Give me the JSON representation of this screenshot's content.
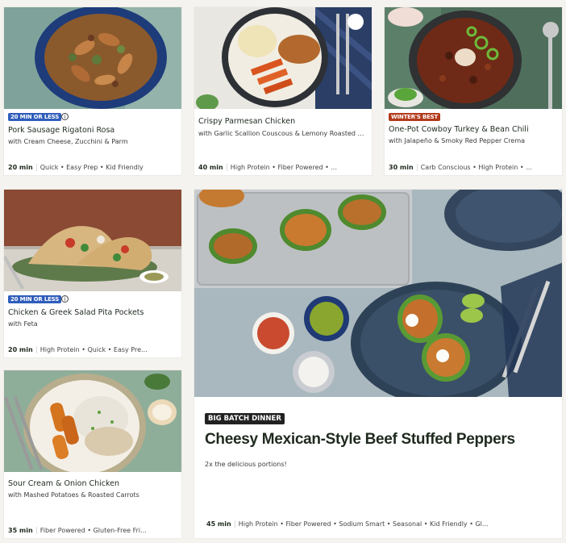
{
  "recipes": [
    {
      "badge": "20 MIN OR LESS",
      "title": "Pork Sausage Rigatoni Rosa",
      "subtitle": "with Cream Cheese, Zucchini & Parm",
      "time": "20 min",
      "tags": "Quick • Easy Prep • Kid Friendly"
    },
    {
      "badge": "",
      "title": "Crispy Parmesan Chicken",
      "subtitle": "with Garlic Scallion Couscous & Lemony Roasted Ca...",
      "time": "40 min",
      "tags": "High Protein • Fiber Powered • ..."
    },
    {
      "badge": "WINTER'S BEST",
      "title": "One-Pot Cowboy Turkey & Bean Chili",
      "subtitle": "with Jalapeño & Smoky Red Pepper Crema",
      "time": "30 min",
      "tags": "Carb Conscious • High Protein • ..."
    },
    {
      "badge": "20 MIN OR LESS",
      "title": "Chicken & Greek Salad Pita Pockets",
      "subtitle": "with Feta",
      "time": "20 min",
      "tags": "High Protein • Quick • Easy Pre..."
    },
    {
      "badge": "",
      "title": "Sour Cream & Onion Chicken",
      "subtitle": "with Mashed Potatoes & Roasted Carrots",
      "time": "35 min",
      "tags": "Fiber Powered • Gluten-Free Fri..."
    }
  ],
  "featured": {
    "badge": "BIG BATCH DINNER",
    "title": "Cheesy Mexican-Style Beef Stuffed Peppers",
    "subtitle": "2x the delicious portions!",
    "time": "45 min",
    "tags": "High Protein • Fiber Powered • Sodium Smart • Seasonal • Kid Friendly • Gl..."
  },
  "info_icon": "i",
  "colors": {
    "badge_blue": "#2f5dbb",
    "badge_red": "#b33a1c",
    "badge_black": "#222222"
  }
}
